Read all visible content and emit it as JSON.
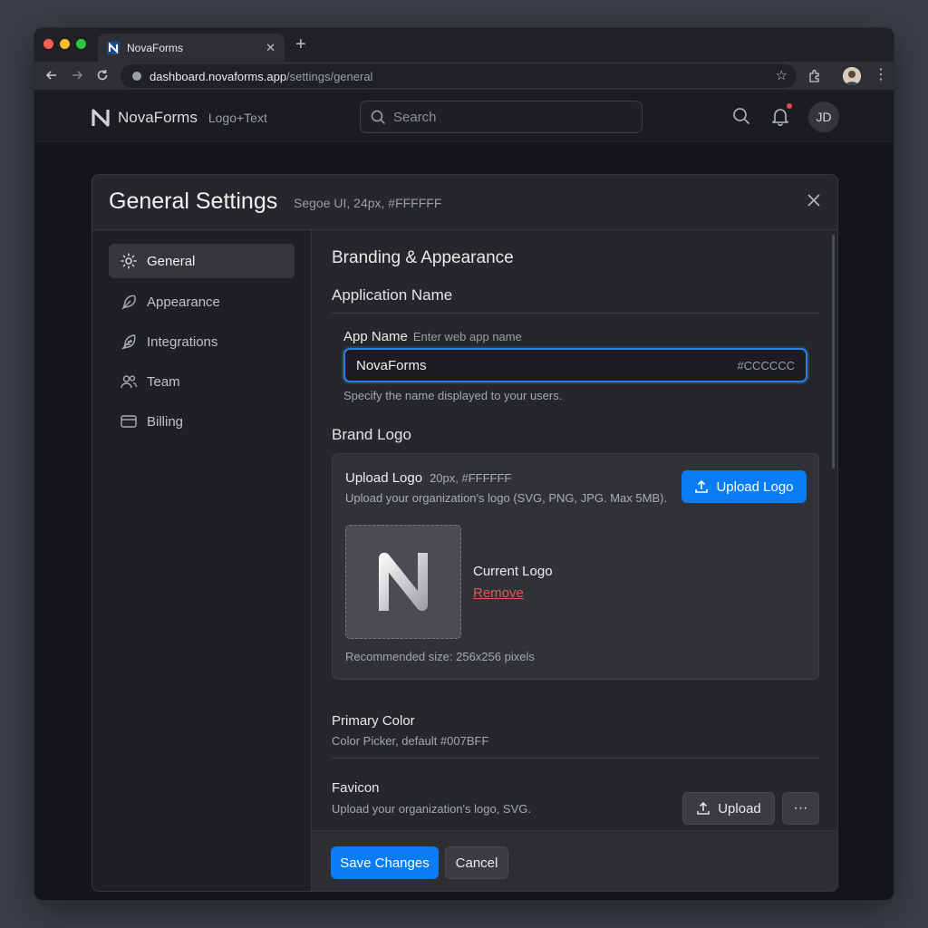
{
  "browser": {
    "tab_title": "NovaForms",
    "tab_close": "✕",
    "new_tab": "+",
    "url_host": "dashboard.novaforms.app",
    "url_path": "/settings/general"
  },
  "header": {
    "brand_name": "NovaForms",
    "brand_note": "Logo+Text",
    "search_placeholder": "Search",
    "avatar_initials": "JD"
  },
  "modal": {
    "title": "General Settings",
    "title_note": "Segoe UI, 24px, #FFFFFF"
  },
  "sidebar": {
    "items": [
      {
        "label": "General",
        "icon": "gear-icon",
        "active": true
      },
      {
        "label": "Appearance",
        "icon": "feather-icon",
        "active": false
      },
      {
        "label": "Integrations",
        "icon": "feather-icon",
        "active": false
      },
      {
        "label": "Team",
        "icon": "users-icon",
        "active": false
      },
      {
        "label": "Billing",
        "icon": "card-icon",
        "active": false
      }
    ]
  },
  "content": {
    "section_title": "Branding & Appearance",
    "app_name_heading": "Application Name",
    "app_name_label": "App Name",
    "app_name_hint": "Enter web app name",
    "app_name_value": "NovaForms",
    "app_name_note": "#CCCCCC",
    "app_name_desc": "Specify the name displayed to your users.",
    "brand_logo_heading": "Brand Logo",
    "upload_logo_title": "Upload Logo",
    "upload_logo_note": "20px, #FFFFFF",
    "upload_logo_desc": "Upload your organization's logo (SVG, PNG, JPG. Max 5MB).",
    "upload_logo_button": "Upload Logo",
    "current_logo_label": "Current Logo",
    "remove_link": "Remove",
    "recommended_size": "Recommended size: 256x256 pixels",
    "primary_color_title": "Primary Color",
    "primary_color_desc": "Color Picker, default #007BFF",
    "favicon_title": "Favicon",
    "favicon_desc": "Upload your organization's logo, SVG.",
    "favicon_upload_button": "Upload",
    "more_button": "···"
  },
  "footer": {
    "save_label": "Save Changes",
    "cancel_label": "Cancel"
  },
  "colors": {
    "accent": "#0A7CF5",
    "danger": "#E0575B",
    "notification_dot": "#E5484D"
  }
}
